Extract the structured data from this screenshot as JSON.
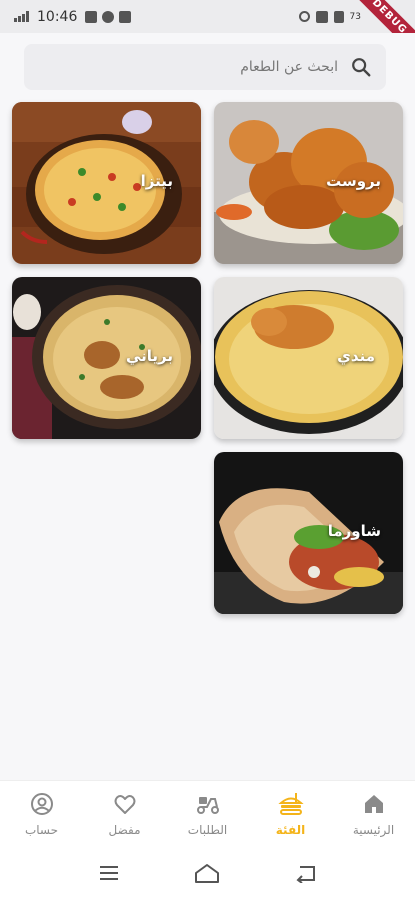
{
  "status_bar": {
    "time": "10:46",
    "battery": "73",
    "debug_banner": "DEBUG"
  },
  "search": {
    "placeholder": "ابحث عن الطعام"
  },
  "categories": [
    {
      "label": "بروست"
    },
    {
      "label": "بيتزا"
    },
    {
      "label": "مندي"
    },
    {
      "label": "برياني"
    },
    {
      "label": "شاورما"
    }
  ],
  "bottom_nav": {
    "items": [
      {
        "label": "الرئيسية",
        "icon": "home-icon",
        "active": false
      },
      {
        "label": "الفئة",
        "icon": "category-burger-icon",
        "active": true
      },
      {
        "label": "الطلبات",
        "icon": "delivery-scooter-icon",
        "active": false
      },
      {
        "label": "مفضل",
        "icon": "heart-icon",
        "active": false
      },
      {
        "label": "حساب",
        "icon": "account-icon",
        "active": false
      }
    ]
  },
  "colors": {
    "accent": "#f4b41a",
    "inactive": "#8a8a8a",
    "background": "#f7f7f9"
  }
}
